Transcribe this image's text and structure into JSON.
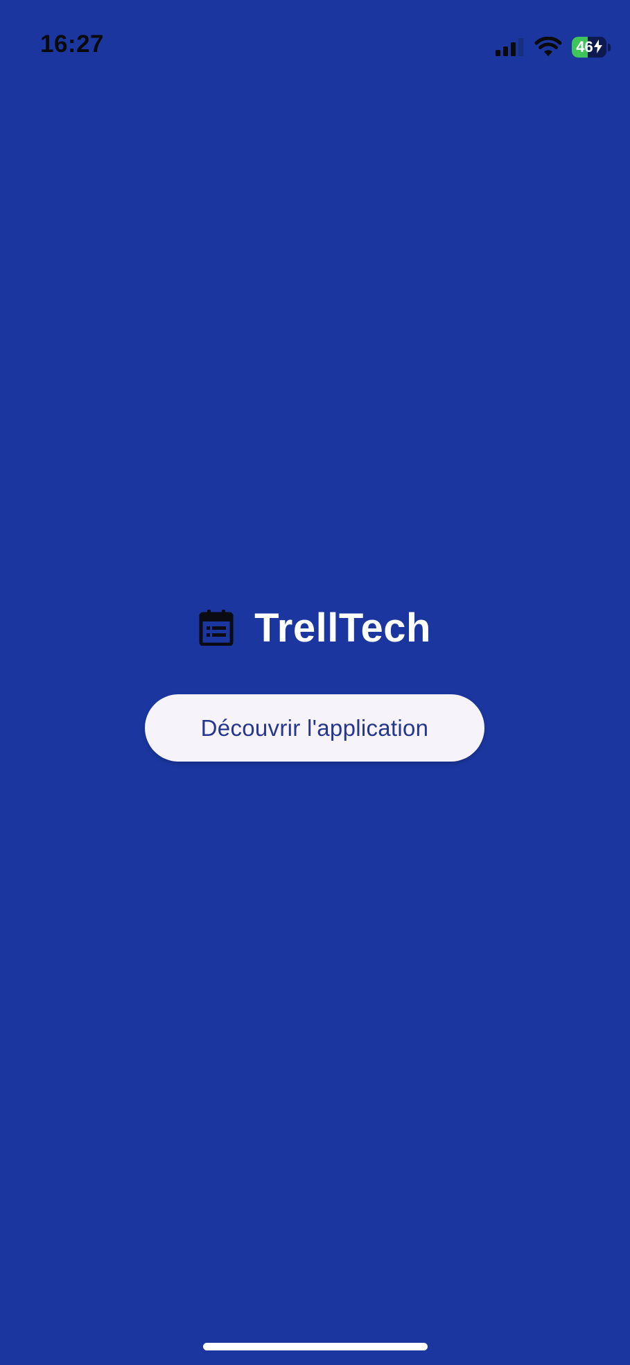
{
  "status_bar": {
    "time": "16:27",
    "battery_level": "46",
    "battery_percent": 46,
    "charging": true,
    "icons": [
      "signal-icon",
      "wifi-icon",
      "battery-icon",
      "charging-bolt-icon"
    ]
  },
  "brand": {
    "icon": "calendar-icon",
    "title": "TrellTech"
  },
  "cta": {
    "label": "Découvrir l'application"
  },
  "colors": {
    "background": "#1b379f",
    "button_background": "#f6f3fb",
    "button_text": "#25368f",
    "title_text": "#ffffff",
    "battery_fill": "#3fc35b"
  }
}
